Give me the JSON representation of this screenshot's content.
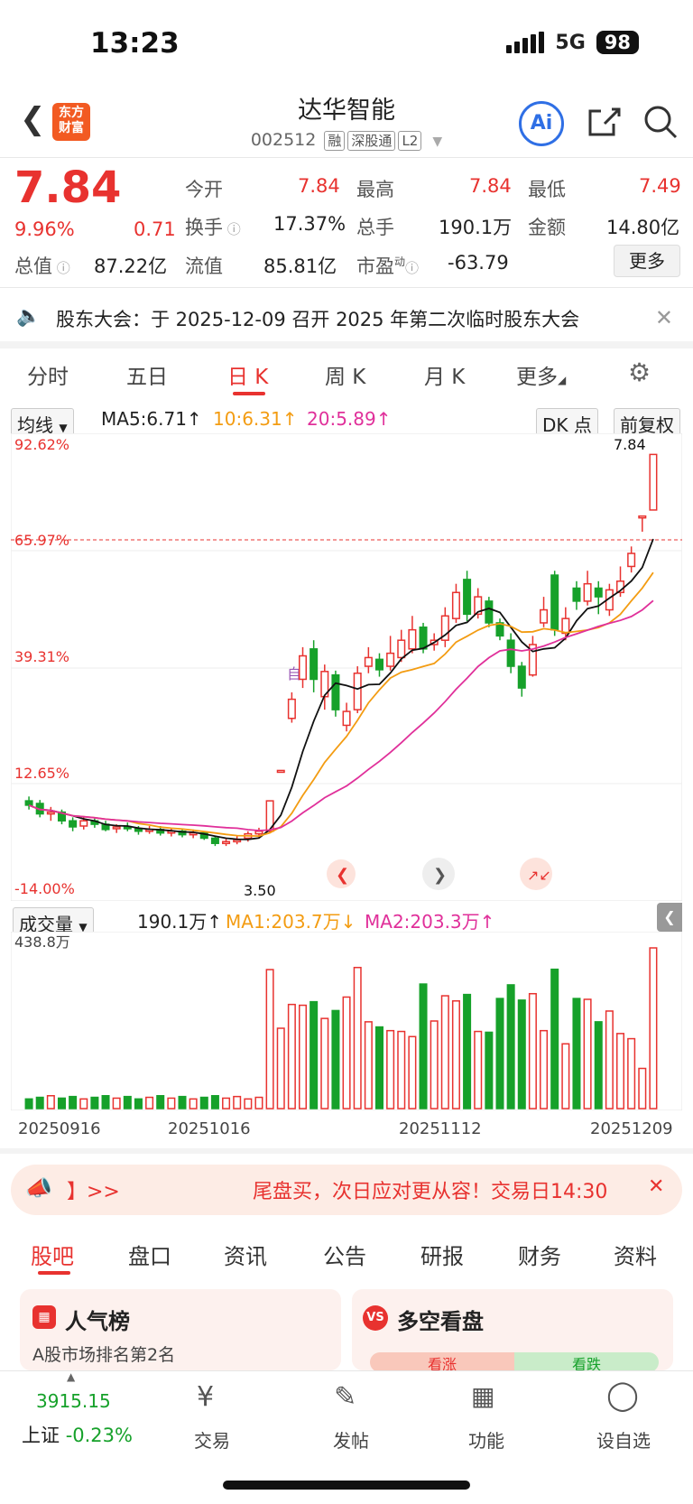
{
  "status": {
    "time": "13:23",
    "network": "5G",
    "battery": "98"
  },
  "header": {
    "title": "达华智能",
    "code": "002512",
    "tags": [
      "融",
      "深股通",
      "L2"
    ],
    "logo": "东方\n财富",
    "ai": "Ai"
  },
  "quote": {
    "price": "7.84",
    "pct": "9.96%",
    "change": "0.71",
    "open_label": "今开",
    "open": "7.84",
    "high_label": "最高",
    "high": "7.84",
    "low_label": "最低",
    "low": "7.49",
    "turnover_label": "换手",
    "turnover": "17.37%",
    "vol_label": "总手",
    "vol": "190.1万",
    "amount_label": "金额",
    "amount": "14.80亿",
    "mktcap_label": "总值",
    "mktcap": "87.22亿",
    "float_label": "流值",
    "float": "85.81亿",
    "pe_label": "市盈",
    "pe_sup": "动",
    "pe": "-63.79",
    "more": "更多"
  },
  "notice": {
    "text": "股东大会：于 2025-12-09 召开 2025 年第二次临时股东大会"
  },
  "ktabs": [
    "分时",
    "五日",
    "日 K",
    "周 K",
    "月 K",
    "更多"
  ],
  "ma": {
    "select": "均线",
    "ma5": "MA5:6.71↑",
    "ma10": "10:6.31↑",
    "ma20": "20:5.89↑",
    "dk": "DK 点",
    "fq": "前复权"
  },
  "axis": {
    "top": "92.62%",
    "l2": "65.97%",
    "l3": "39.31%",
    "l4": "12.65%",
    "bottom": "-14.00%",
    "vol_max": "438.8万",
    "last": "7.84",
    "min_label": "3.50",
    "self": "自"
  },
  "volume": {
    "select": "成交量",
    "vol": "190.1万↑",
    "ma1": "MA1:203.7万↓",
    "ma2": "MA2:203.3万↑"
  },
  "dates": [
    "20250916",
    "20251016",
    "20251112",
    "20251209"
  ],
  "banner": {
    "left": "】>>",
    "text": "尾盘买，次日应对更从容！交易日14:30"
  },
  "btabs": [
    "股吧",
    "盘口",
    "资讯",
    "公告",
    "研报",
    "财务",
    "资料"
  ],
  "cards": {
    "hot": "人气榜",
    "hot_sub": "A股市场排名第2名",
    "duokong": "多空看盘",
    "up": "看涨",
    "down": "看跌"
  },
  "bottom": {
    "index_val": "3915.15",
    "index": "上证",
    "index_pct": "-0.23%",
    "trade": "交易",
    "post": "发帖",
    "func": "功能",
    "fav": "设自选"
  },
  "colors": {
    "up": "#e8322f",
    "down": "#16a12a",
    "ma5": "#111111",
    "ma10": "#f39c12",
    "ma20": "#e0309a"
  },
  "chart_data": {
    "type": "candlestick",
    "candles": [
      {
        "o": 3.85,
        "c": 3.8,
        "h": 3.9,
        "l": 3.75
      },
      {
        "o": 3.82,
        "c": 3.7,
        "h": 3.86,
        "l": 3.66
      },
      {
        "o": 3.7,
        "c": 3.72,
        "h": 3.78,
        "l": 3.62
      },
      {
        "o": 3.72,
        "c": 3.62,
        "h": 3.75,
        "l": 3.58
      },
      {
        "o": 3.62,
        "c": 3.55,
        "h": 3.66,
        "l": 3.5
      },
      {
        "o": 3.56,
        "c": 3.62,
        "h": 3.66,
        "l": 3.52
      },
      {
        "o": 3.62,
        "c": 3.58,
        "h": 3.66,
        "l": 3.54
      },
      {
        "o": 3.58,
        "c": 3.52,
        "h": 3.62,
        "l": 3.5
      },
      {
        "o": 3.54,
        "c": 3.55,
        "h": 3.58,
        "l": 3.48
      },
      {
        "o": 3.55,
        "c": 3.53,
        "h": 3.6,
        "l": 3.5
      },
      {
        "o": 3.53,
        "c": 3.5,
        "h": 3.56,
        "l": 3.46
      },
      {
        "o": 3.5,
        "c": 3.52,
        "h": 3.56,
        "l": 3.47
      },
      {
        "o": 3.52,
        "c": 3.48,
        "h": 3.56,
        "l": 3.45
      },
      {
        "o": 3.48,
        "c": 3.5,
        "h": 3.53,
        "l": 3.44
      },
      {
        "o": 3.5,
        "c": 3.46,
        "h": 3.53,
        "l": 3.43
      },
      {
        "o": 3.46,
        "c": 3.48,
        "h": 3.52,
        "l": 3.42
      },
      {
        "o": 3.48,
        "c": 3.42,
        "h": 3.5,
        "l": 3.4
      },
      {
        "o": 3.42,
        "c": 3.36,
        "h": 3.45,
        "l": 3.33
      },
      {
        "o": 3.37,
        "c": 3.38,
        "h": 3.42,
        "l": 3.33
      },
      {
        "o": 3.38,
        "c": 3.4,
        "h": 3.45,
        "l": 3.35
      },
      {
        "o": 3.42,
        "c": 3.47,
        "h": 3.5,
        "l": 3.38
      },
      {
        "o": 3.47,
        "c": 3.5,
        "h": 3.54,
        "l": 3.42
      },
      {
        "o": 3.5,
        "c": 3.85,
        "h": 3.85,
        "l": 3.48
      },
      {
        "o": 4.2,
        "c": 4.2,
        "h": 4.2,
        "l": 4.2
      },
      {
        "o": 4.8,
        "c": 5.02,
        "h": 5.1,
        "l": 4.75
      },
      {
        "o": 5.25,
        "c": 5.52,
        "h": 5.62,
        "l": 5.15
      },
      {
        "o": 5.6,
        "c": 5.25,
        "h": 5.7,
        "l": 5.1
      },
      {
        "o": 5.05,
        "c": 5.34,
        "h": 5.42,
        "l": 4.9
      },
      {
        "o": 5.3,
        "c": 4.9,
        "h": 5.35,
        "l": 4.82
      },
      {
        "o": 4.72,
        "c": 4.88,
        "h": 4.98,
        "l": 4.65
      },
      {
        "o": 4.9,
        "c": 5.32,
        "h": 5.4,
        "l": 4.86
      },
      {
        "o": 5.4,
        "c": 5.5,
        "h": 5.62,
        "l": 5.32
      },
      {
        "o": 5.48,
        "c": 5.36,
        "h": 5.55,
        "l": 5.28
      },
      {
        "o": 5.4,
        "c": 5.55,
        "h": 5.75,
        "l": 5.35
      },
      {
        "o": 5.5,
        "c": 5.7,
        "h": 5.82,
        "l": 5.45
      },
      {
        "o": 5.6,
        "c": 5.82,
        "h": 5.98,
        "l": 5.55
      },
      {
        "o": 5.85,
        "c": 5.6,
        "h": 5.9,
        "l": 5.55
      },
      {
        "o": 5.65,
        "c": 5.7,
        "h": 5.78,
        "l": 5.58
      },
      {
        "o": 5.7,
        "c": 5.98,
        "h": 6.08,
        "l": 5.62
      },
      {
        "o": 5.95,
        "c": 6.25,
        "h": 6.35,
        "l": 5.9
      },
      {
        "o": 6.4,
        "c": 6.0,
        "h": 6.5,
        "l": 5.92
      },
      {
        "o": 6.0,
        "c": 6.2,
        "h": 6.3,
        "l": 5.95
      },
      {
        "o": 6.15,
        "c": 5.9,
        "h": 6.2,
        "l": 5.85
      },
      {
        "o": 5.9,
        "c": 5.75,
        "h": 5.95,
        "l": 5.7
      },
      {
        "o": 5.7,
        "c": 5.4,
        "h": 5.78,
        "l": 5.32
      },
      {
        "o": 5.4,
        "c": 5.15,
        "h": 5.45,
        "l": 5.05
      },
      {
        "o": 5.3,
        "c": 5.65,
        "h": 5.75,
        "l": 5.28
      },
      {
        "o": 5.9,
        "c": 6.05,
        "h": 6.2,
        "l": 5.85
      },
      {
        "o": 6.45,
        "c": 5.82,
        "h": 6.5,
        "l": 5.75
      },
      {
        "o": 5.78,
        "c": 5.95,
        "h": 6.08,
        "l": 5.7
      },
      {
        "o": 6.3,
        "c": 6.15,
        "h": 6.38,
        "l": 6.05
      },
      {
        "o": 6.15,
        "c": 6.35,
        "h": 6.5,
        "l": 6.1
      },
      {
        "o": 6.3,
        "c": 6.2,
        "h": 6.38,
        "l": 6.0
      },
      {
        "o": 6.05,
        "c": 6.28,
        "h": 6.35,
        "l": 5.98
      },
      {
        "o": 6.25,
        "c": 6.38,
        "h": 6.55,
        "l": 6.2
      },
      {
        "o": 6.55,
        "c": 6.7,
        "h": 6.78,
        "l": 6.48
      },
      {
        "o": 7.13,
        "c": 7.13,
        "h": 7.13,
        "l": 6.95
      },
      {
        "o": 7.2,
        "c": 7.84,
        "h": 7.84,
        "l": 7.49
      }
    ]
  }
}
